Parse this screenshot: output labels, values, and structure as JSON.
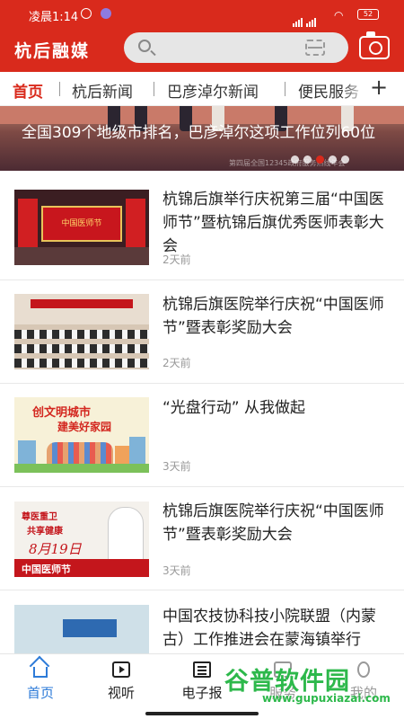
{
  "status_bar": {
    "time": "凌晨1:14",
    "battery": "52"
  },
  "header": {
    "app_title": "杭后融媒",
    "search_placeholder": ""
  },
  "tabs": [
    {
      "label": "首页",
      "active": true
    },
    {
      "label": "杭后新闻",
      "active": false
    },
    {
      "label": "巴彦淖尔新闻",
      "active": false
    },
    {
      "label": "便民服务",
      "active": false
    }
  ],
  "tabs_add_icon": "plus-icon",
  "banner": {
    "headline": "全国309个地级市排名，巴彦淖尔这项工作位列60位",
    "caption": "第四届全国12345政府服务热线年会",
    "slide_count": 5,
    "active_slide": 3
  },
  "news": [
    {
      "title": "杭锦后旗举行庆祝第三届“中国医师节”暨杭锦后旗优秀医师表彰大会",
      "time": "2天前",
      "thumb_text": "中国医师节"
    },
    {
      "title": "杭锦后旗医院举行庆祝“中国医师节”暨表彰奖励大会",
      "time": "2天前"
    },
    {
      "title": "“光盘行动” 从我做起",
      "time": "3天前",
      "thumb_text_1": "创文明城市",
      "thumb_text_2": "建美好家园"
    },
    {
      "title": "杭锦后旗医院举行庆祝“中国医师节”暨表彰奖励大会",
      "time": "3天前",
      "thumb_text_1": "尊医重卫",
      "thumb_text_2": "共享健康",
      "thumb_date": "8月19日",
      "thumb_bar": "中国医师节"
    },
    {
      "title": "中国农技协科技小院联盟（内蒙古）工作推进会在蒙海镇举行",
      "time": ""
    }
  ],
  "bottom_nav": [
    {
      "label": "首页",
      "icon": "home-icon",
      "active": true
    },
    {
      "label": "视听",
      "icon": "tv-icon",
      "active": false
    },
    {
      "label": "电子报",
      "icon": "newspaper-icon",
      "active": false
    },
    {
      "label": "服务",
      "icon": "grid-icon",
      "active": false
    },
    {
      "label": "我的",
      "icon": "user-icon",
      "active": false
    }
  ],
  "watermark": {
    "logo": "谷普软件园",
    "url": "www.gupuxiazai.com"
  },
  "colors": {
    "brand_red": "#d92a1c",
    "nav_active_blue": "#2d7bd8",
    "watermark_green": "#2db84b"
  }
}
